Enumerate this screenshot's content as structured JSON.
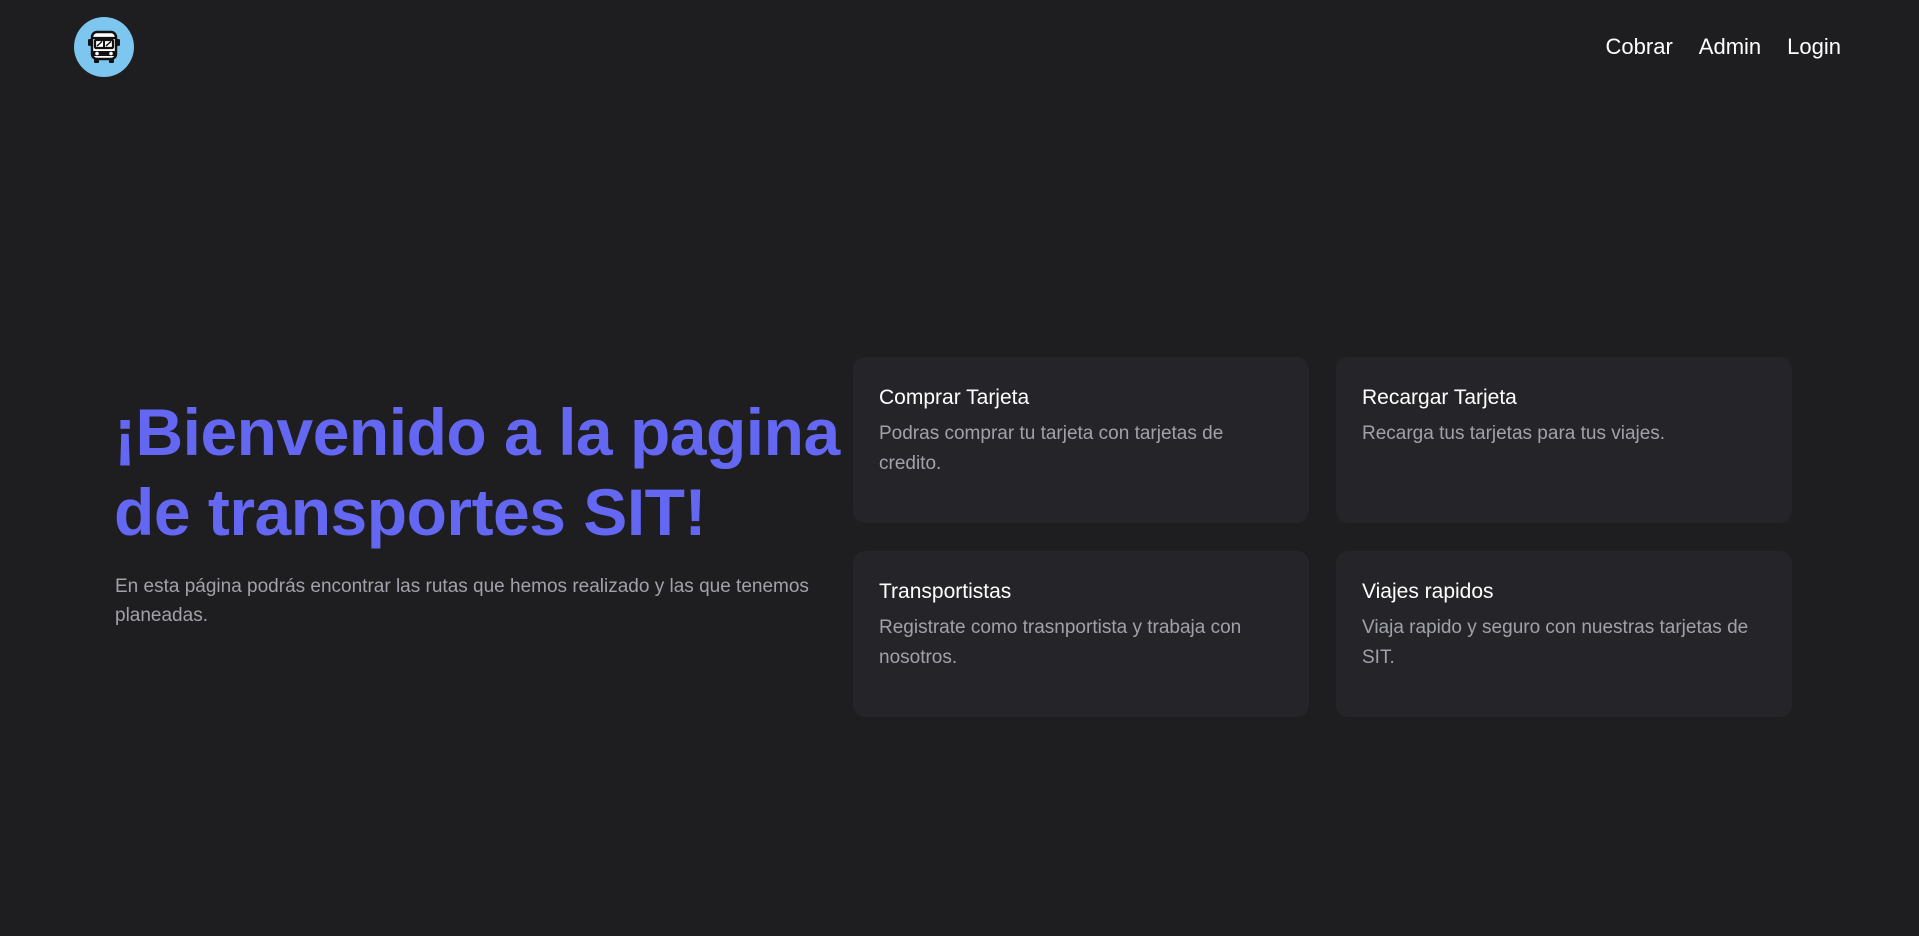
{
  "header": {
    "logo_icon": "bus-icon",
    "logo_bg": "#7cc6ef",
    "nav": [
      {
        "label": "Cobrar"
      },
      {
        "label": "Admin"
      },
      {
        "label": "Login"
      }
    ]
  },
  "hero": {
    "title": "¡Bienvenido a la pagina de transportes SIT!",
    "description": "En esta página podrás encontrar las rutas que hemos realizado y las que tenemos planeadas.",
    "accent": "#6467f2"
  },
  "cards": [
    {
      "title": "Comprar Tarjeta",
      "description": "Podras comprar tu tarjeta con tarjetas de credito."
    },
    {
      "title": "Recargar Tarjeta",
      "description": "Recarga tus tarjetas para tus viajes."
    },
    {
      "title": "Transportistas",
      "description": "Registrate como trasnportista y trabaja con nosotros."
    },
    {
      "title": "Viajes rapidos",
      "description": "Viaja rapido y seguro con nuestras tarjetas de SIT."
    }
  ]
}
